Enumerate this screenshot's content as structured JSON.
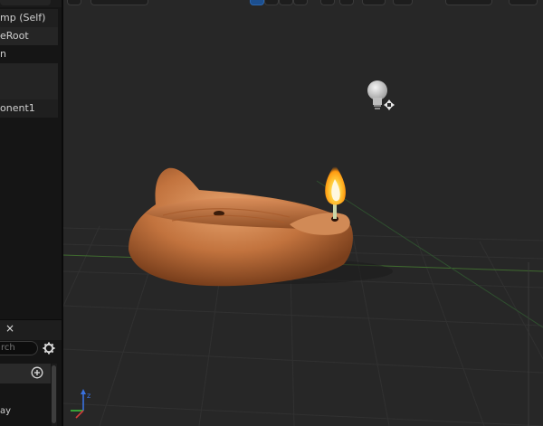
{
  "components": {
    "items": [
      {
        "label": "mp (Self)"
      },
      {
        "label": "eRoot"
      },
      {
        "label": "n"
      },
      {
        "label": ""
      },
      {
        "label": ""
      },
      {
        "label": "onent1"
      }
    ]
  },
  "details": {
    "tab_close": "×",
    "search_placeholder": "rch",
    "row1": "ay"
  },
  "colors": {
    "flame": "#ffb21e",
    "lamp": "#c9763e",
    "bulb": "#d8d8d8",
    "axis_x": "#d23c3c",
    "axis_y": "#3cbf3c",
    "axis_z": "#3a72e0"
  },
  "icons": {
    "settings": "gear-icon",
    "add": "add-circle-icon",
    "light": "point-light-icon",
    "axis": "axis-gizmo-icon"
  }
}
